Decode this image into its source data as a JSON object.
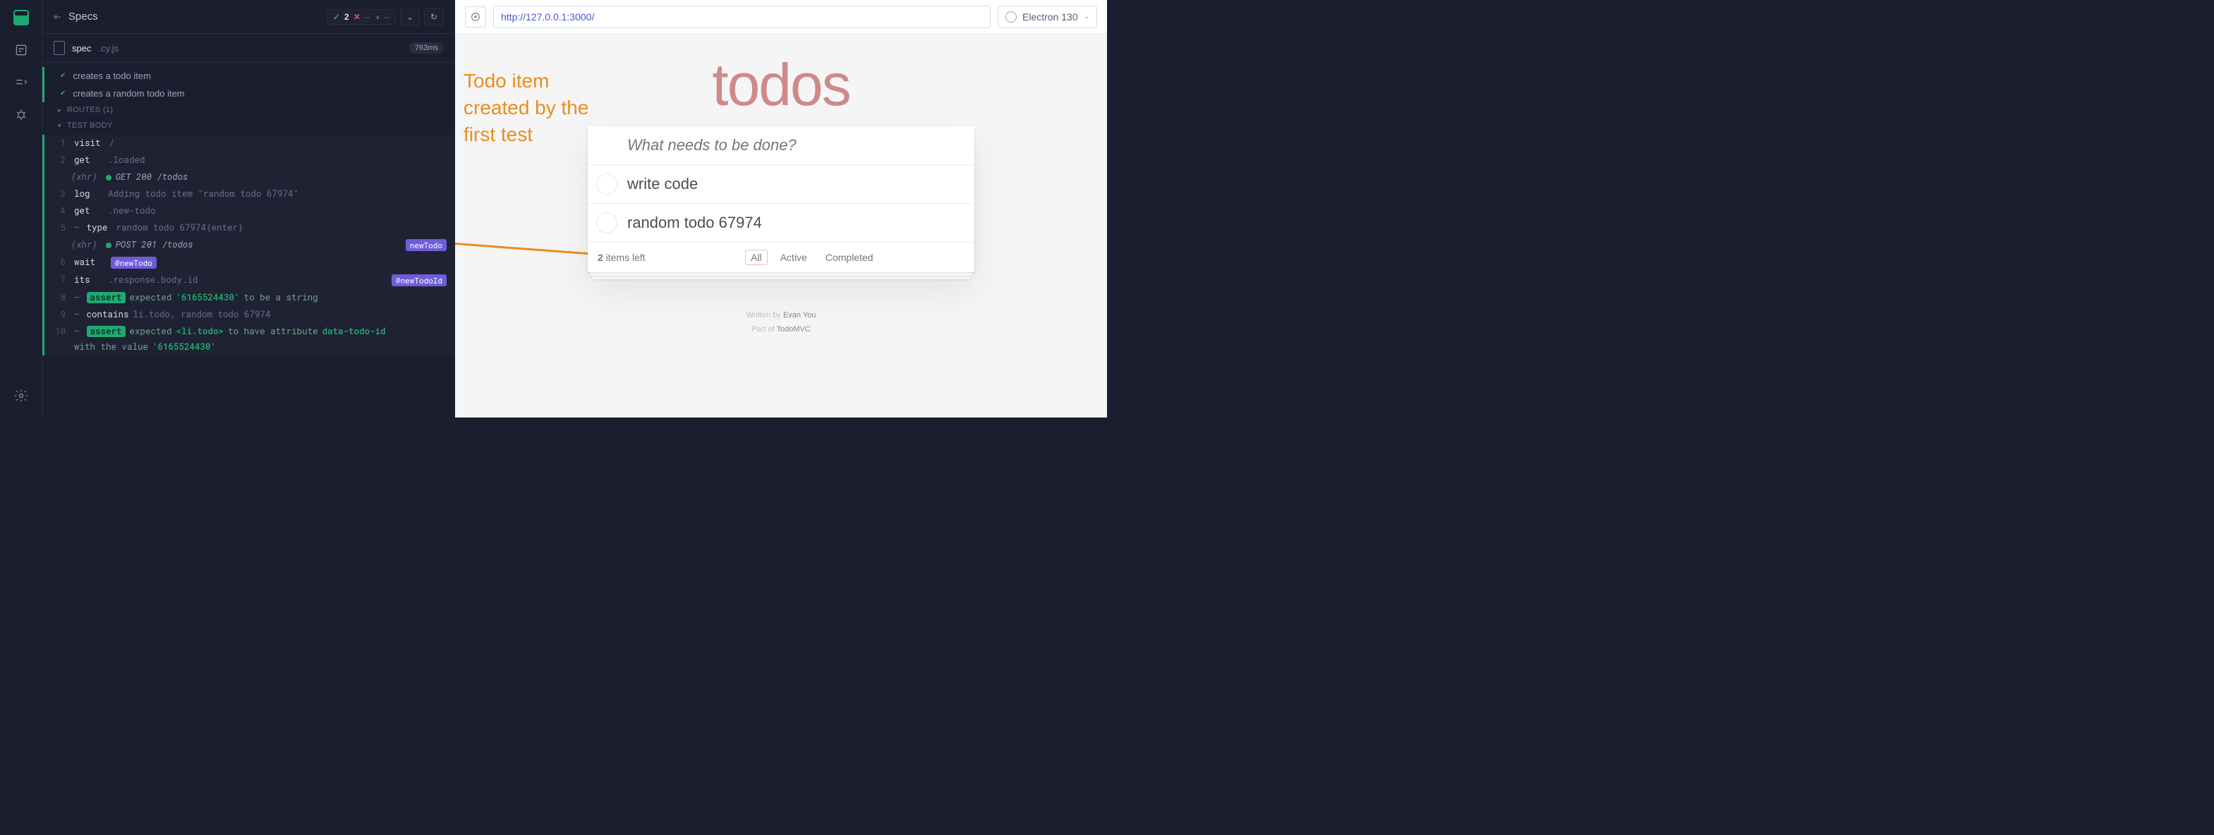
{
  "header": {
    "title": "Specs"
  },
  "stats": {
    "pass": 2,
    "fail": "--",
    "pending": "--"
  },
  "spec_file": {
    "name": "spec",
    "ext": ".cy.js",
    "duration": "763ms"
  },
  "tests": {
    "items": [
      "creates a todo item",
      "creates a random todo item"
    ],
    "routes_label": "ROUTES (1)",
    "body_label": "TEST BODY"
  },
  "log": {
    "l1": {
      "n": "1",
      "cmd": "visit",
      "args": "/"
    },
    "l2": {
      "n": "2",
      "cmd": "get",
      "args": ".loaded"
    },
    "x1": {
      "label": "(xhr)",
      "text": "GET 200 /todos"
    },
    "l3": {
      "n": "3",
      "cmd": "log",
      "args": "Adding todo item \"random todo 67974\""
    },
    "l4": {
      "n": "4",
      "cmd": "get",
      "args": ".new-todo"
    },
    "l5": {
      "n": "5",
      "cmd": "type",
      "args": "random todo 67974{enter}"
    },
    "x2": {
      "label": "(xhr)",
      "text": "POST 201 /todos",
      "alias": "newTodo"
    },
    "l6": {
      "n": "6",
      "cmd": "wait",
      "alias": "@newTodo"
    },
    "l7": {
      "n": "7",
      "cmd": "its",
      "args": ".response.body.id",
      "alias": "@newTodoId"
    },
    "l8": {
      "n": "8",
      "pill": "assert",
      "t_exp": "expected",
      "v1": "'6165524430'",
      "t_to": "to be a string"
    },
    "l9": {
      "n": "9",
      "cmd": "contains",
      "args": "li.todo, random todo 67974"
    },
    "l10": {
      "n": "10",
      "pill": "assert",
      "t_exp": "expected",
      "el": "<li.todo>",
      "t_mid": "to have attribute",
      "attr": "data-todo-id",
      "t_with": "with the value",
      "v2": "'6165524430'"
    }
  },
  "url": "http://127.0.0.1:3000/",
  "browser": "Electron 130",
  "annotation": "Todo item created by the first test",
  "todoapp": {
    "title": "todos",
    "placeholder": "What needs to be done?",
    "items": [
      "write code",
      "random todo 67974"
    ],
    "count_n": "2",
    "count_text": " items left",
    "filters": {
      "all": "All",
      "active": "Active",
      "completed": "Completed"
    },
    "credit1_a": "Written by ",
    "credit1_b": "Evan You",
    "credit2_a": "Part of ",
    "credit2_b": "TodoMVC"
  }
}
